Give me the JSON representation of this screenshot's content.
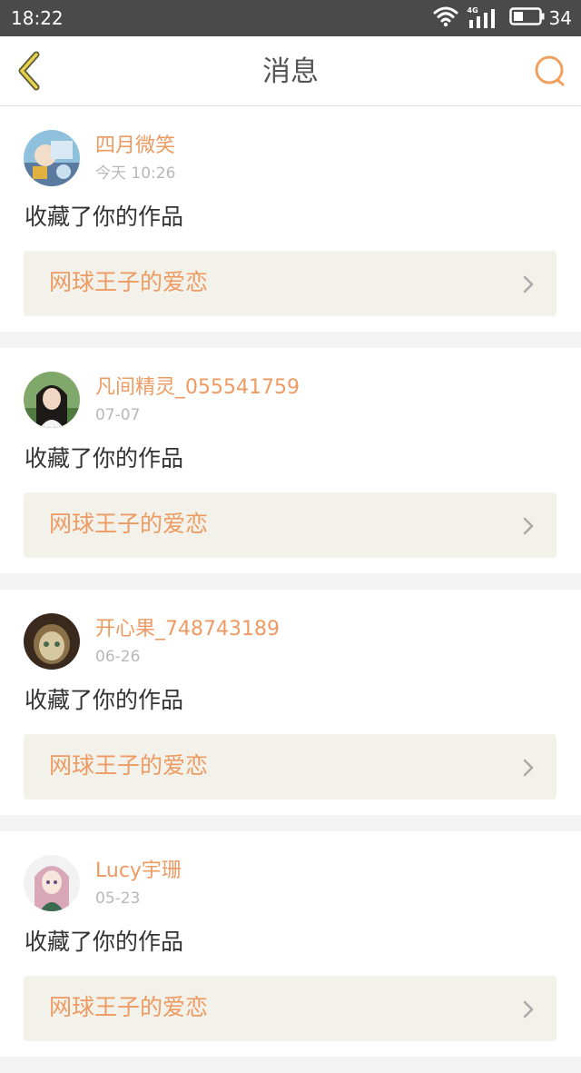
{
  "status_bar": {
    "time": "18:22",
    "network_label": "4G",
    "battery": "34",
    "icons": [
      "wifi-icon",
      "signal-icon",
      "battery-icon"
    ]
  },
  "header": {
    "title": "消息",
    "back_icon": "back-chevron-icon",
    "search_icon": "search-icon"
  },
  "colors": {
    "accent": "#ee9a63",
    "status_bar": "#4a4a4a",
    "link_bg": "#f2f2ea",
    "divider_bg": "#f3f3f3"
  },
  "messages": [
    {
      "username": "四月微笑",
      "time": "今天 10:26",
      "action": "收藏了你的作品",
      "work_title": "网球王子的爱恋"
    },
    {
      "username": "凡间精灵_055541759",
      "time": "07-07",
      "action": "收藏了你的作品",
      "work_title": "网球王子的爱恋"
    },
    {
      "username": "开心果_748743189",
      "time": "06-26",
      "action": "收藏了你的作品",
      "work_title": "网球王子的爱恋"
    },
    {
      "username": "Lucy宇珊",
      "time": "05-23",
      "action": "收藏了你的作品",
      "work_title": "网球王子的爱恋"
    }
  ]
}
